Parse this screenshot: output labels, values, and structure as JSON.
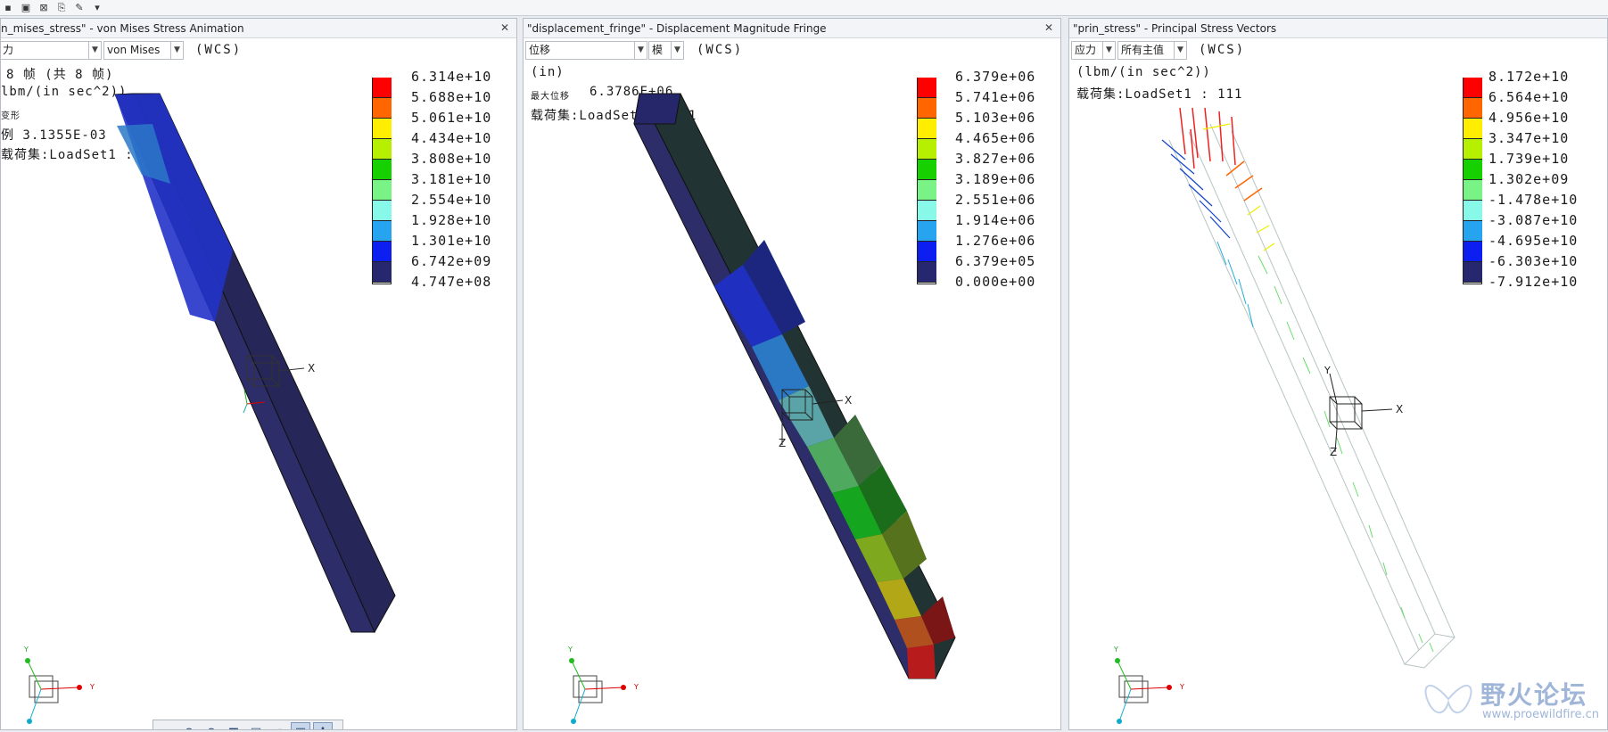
{
  "toolbar": {
    "icons": [
      "save-icon",
      "save-copy-icon",
      "close-icon",
      "export-icon",
      "draw-icon",
      "menu-arrow-icon"
    ]
  },
  "panels": [
    {
      "title": "n_mises_stress\" - von Mises Stress Animation",
      "dropdowns": [
        "力",
        "von Mises"
      ],
      "wcs": "(WCS)",
      "info": [
        "8 帧 (共 8 帧)",
        "lbm/(in sec^2))",
        "变形",
        "例  3.1355E-03",
        "载荷集:LoadSet1  : 111"
      ],
      "legend_values": [
        "6.314e+10",
        "5.688e+10",
        "5.061e+10",
        "4.434e+10",
        "3.808e+10",
        "3.181e+10",
        "2.554e+10",
        "1.928e+10",
        "1.301e+10",
        "6.742e+09",
        "4.747e+08"
      ]
    },
    {
      "title": "\"displacement_fringe\" - Displacement Magnitude Fringe",
      "dropdowns": [
        "位移",
        "模"
      ],
      "wcs": "(WCS)",
      "info": [
        "(in)",
        "最大位移",
        "6.3786E+06",
        "载荷集:LoadSet1  :  111"
      ],
      "legend_values": [
        "6.379e+06",
        "5.741e+06",
        "5.103e+06",
        "4.465e+06",
        "3.827e+06",
        "3.189e+06",
        "2.551e+06",
        "1.914e+06",
        "1.276e+06",
        "6.379e+05",
        "0.000e+00"
      ]
    },
    {
      "title": "\"prin_stress\" - Principal Stress Vectors",
      "dropdowns": [
        "应力",
        "所有主值"
      ],
      "wcs": "(WCS)",
      "info": [
        "(lbm/(in sec^2))",
        "载荷集:LoadSet1  :  111"
      ],
      "legend_values": [
        "8.172e+10",
        "6.564e+10",
        "4.956e+10",
        "3.347e+10",
        "1.739e+10",
        "1.302e+09",
        "-1.478e+10",
        "-3.087e+10",
        "-4.695e+10",
        "-6.303e+10",
        "-7.912e+10"
      ]
    }
  ],
  "legend_colors": [
    "#ff0000",
    "#ff6600",
    "#ffee00",
    "#b6f000",
    "#16d000",
    "#79f286",
    "#88f8e8",
    "#27a4f0",
    "#0c1ff0",
    "#26276e"
  ],
  "axis_labels": {
    "x": "X",
    "y": "Y",
    "z": "Z"
  },
  "bottom_tools": [
    "zoom-fit-icon",
    "zoom-in-icon",
    "zoom-out-icon",
    "refit-icon",
    "view-icon",
    "orient-icon",
    "display-style-icon",
    "spin-center-icon"
  ],
  "watermark": {
    "text": "野火论坛",
    "url": "www.proewildfire.cn"
  }
}
